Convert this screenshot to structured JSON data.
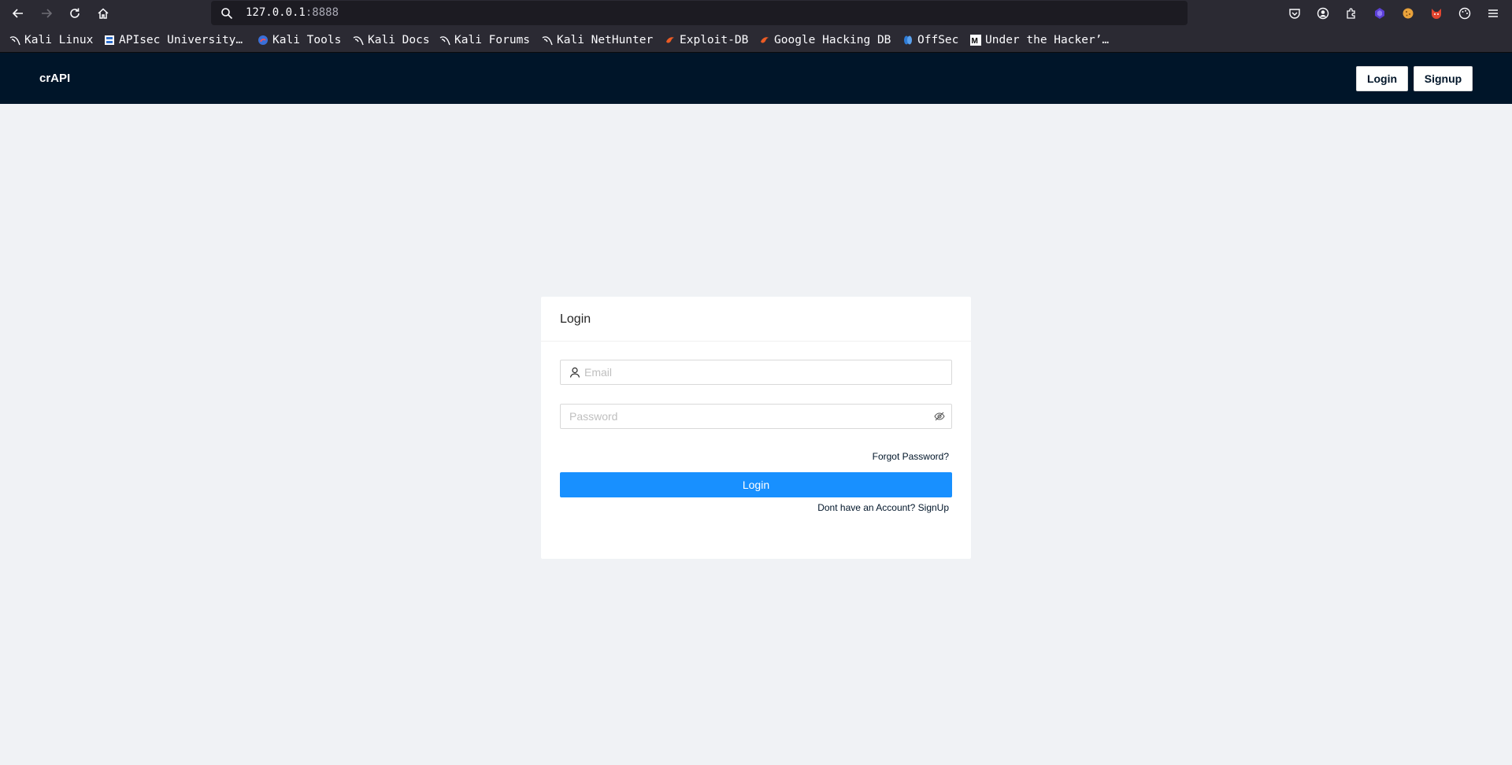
{
  "browser": {
    "url_host": "127.0.0.1",
    "url_port": ":8888",
    "bookmarks": [
      {
        "label": "Kali Linux",
        "icon": "kali-dragon-icon"
      },
      {
        "label": "APIsec University…",
        "icon": "apisec-icon"
      },
      {
        "label": "Kali Tools",
        "icon": "kali-tools-icon"
      },
      {
        "label": "Kali Docs",
        "icon": "kali-dragon-icon"
      },
      {
        "label": "Kali Forums",
        "icon": "kali-dragon-icon"
      },
      {
        "label": "Kali NetHunter",
        "icon": "kali-dragon-icon"
      },
      {
        "label": "Exploit-DB",
        "icon": "exploit-db-icon"
      },
      {
        "label": "Google Hacking DB",
        "icon": "exploit-db-icon"
      },
      {
        "label": "OffSec",
        "icon": "offsec-icon"
      },
      {
        "label": "Under the Hacker’…",
        "icon": "medium-icon"
      }
    ]
  },
  "app": {
    "brand": "crAPI",
    "header_login": "Login",
    "header_signup": "Signup"
  },
  "login_card": {
    "title": "Login",
    "email_placeholder": "Email",
    "password_placeholder": "Password",
    "forgot_password": "Forgot Password?",
    "submit_label": "Login",
    "signup_prompt": "Dont have an Account? SignUp"
  },
  "colors": {
    "header_bg": "#001529",
    "page_bg": "#f0f2f5",
    "primary": "#1890ff"
  }
}
